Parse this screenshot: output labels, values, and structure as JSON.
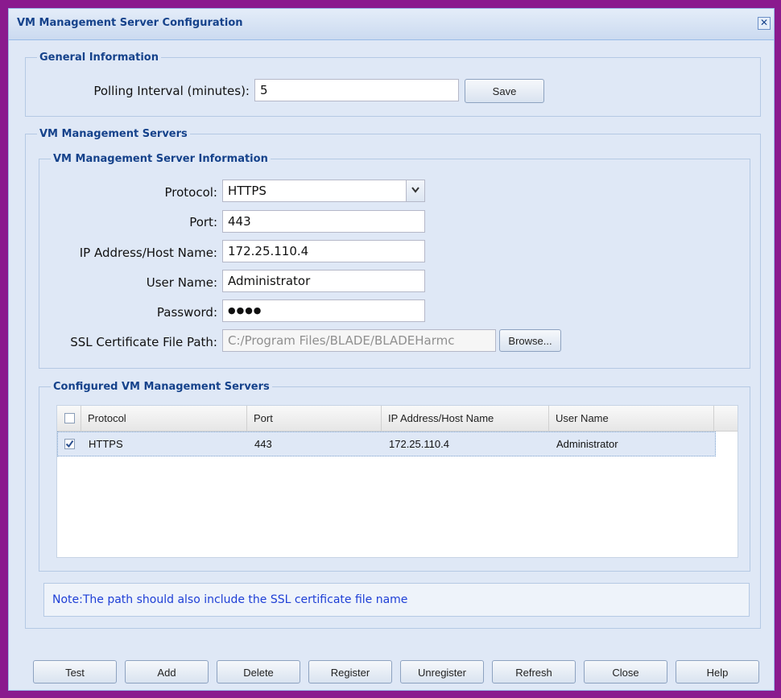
{
  "dialog": {
    "title": "VM Management Server Configuration",
    "close_symbol": "✕"
  },
  "general": {
    "legend": "General Information",
    "polling_label": "Polling Interval (minutes):",
    "polling_value": "5",
    "save_label": "Save"
  },
  "servers": {
    "legend": "VM Management Servers",
    "info": {
      "legend": "VM Management Server Information",
      "protocol_label": "Protocol:",
      "protocol_value": "HTTPS",
      "port_label": "Port:",
      "port_value": "443",
      "ip_label": "IP Address/Host Name:",
      "ip_value": "172.25.110.4",
      "user_label": "User Name:",
      "user_value": "Administrator",
      "password_label": "Password:",
      "password_value": "●●●●",
      "ssl_label": "SSL Certificate File Path:",
      "ssl_value": "C:/Program Files/BLADE/BLADEHarmc",
      "browse_label": "Browse..."
    },
    "configured": {
      "legend": "Configured VM Management Servers",
      "columns": [
        "Protocol",
        "Port",
        "IP Address/Host Name",
        "User Name"
      ],
      "rows": [
        {
          "checked": true,
          "protocol": "HTTPS",
          "port": "443",
          "ip": "172.25.110.4",
          "user": "Administrator"
        }
      ]
    },
    "note": "Note:The path should also include the SSL certificate file name"
  },
  "footer": {
    "buttons": [
      "Test",
      "Add",
      "Delete",
      "Register",
      "Unregister",
      "Refresh",
      "Close",
      "Help"
    ]
  },
  "icons": {
    "close": "close-icon",
    "dropdown": "chevron-down-icon",
    "check": "checkmark-icon"
  }
}
